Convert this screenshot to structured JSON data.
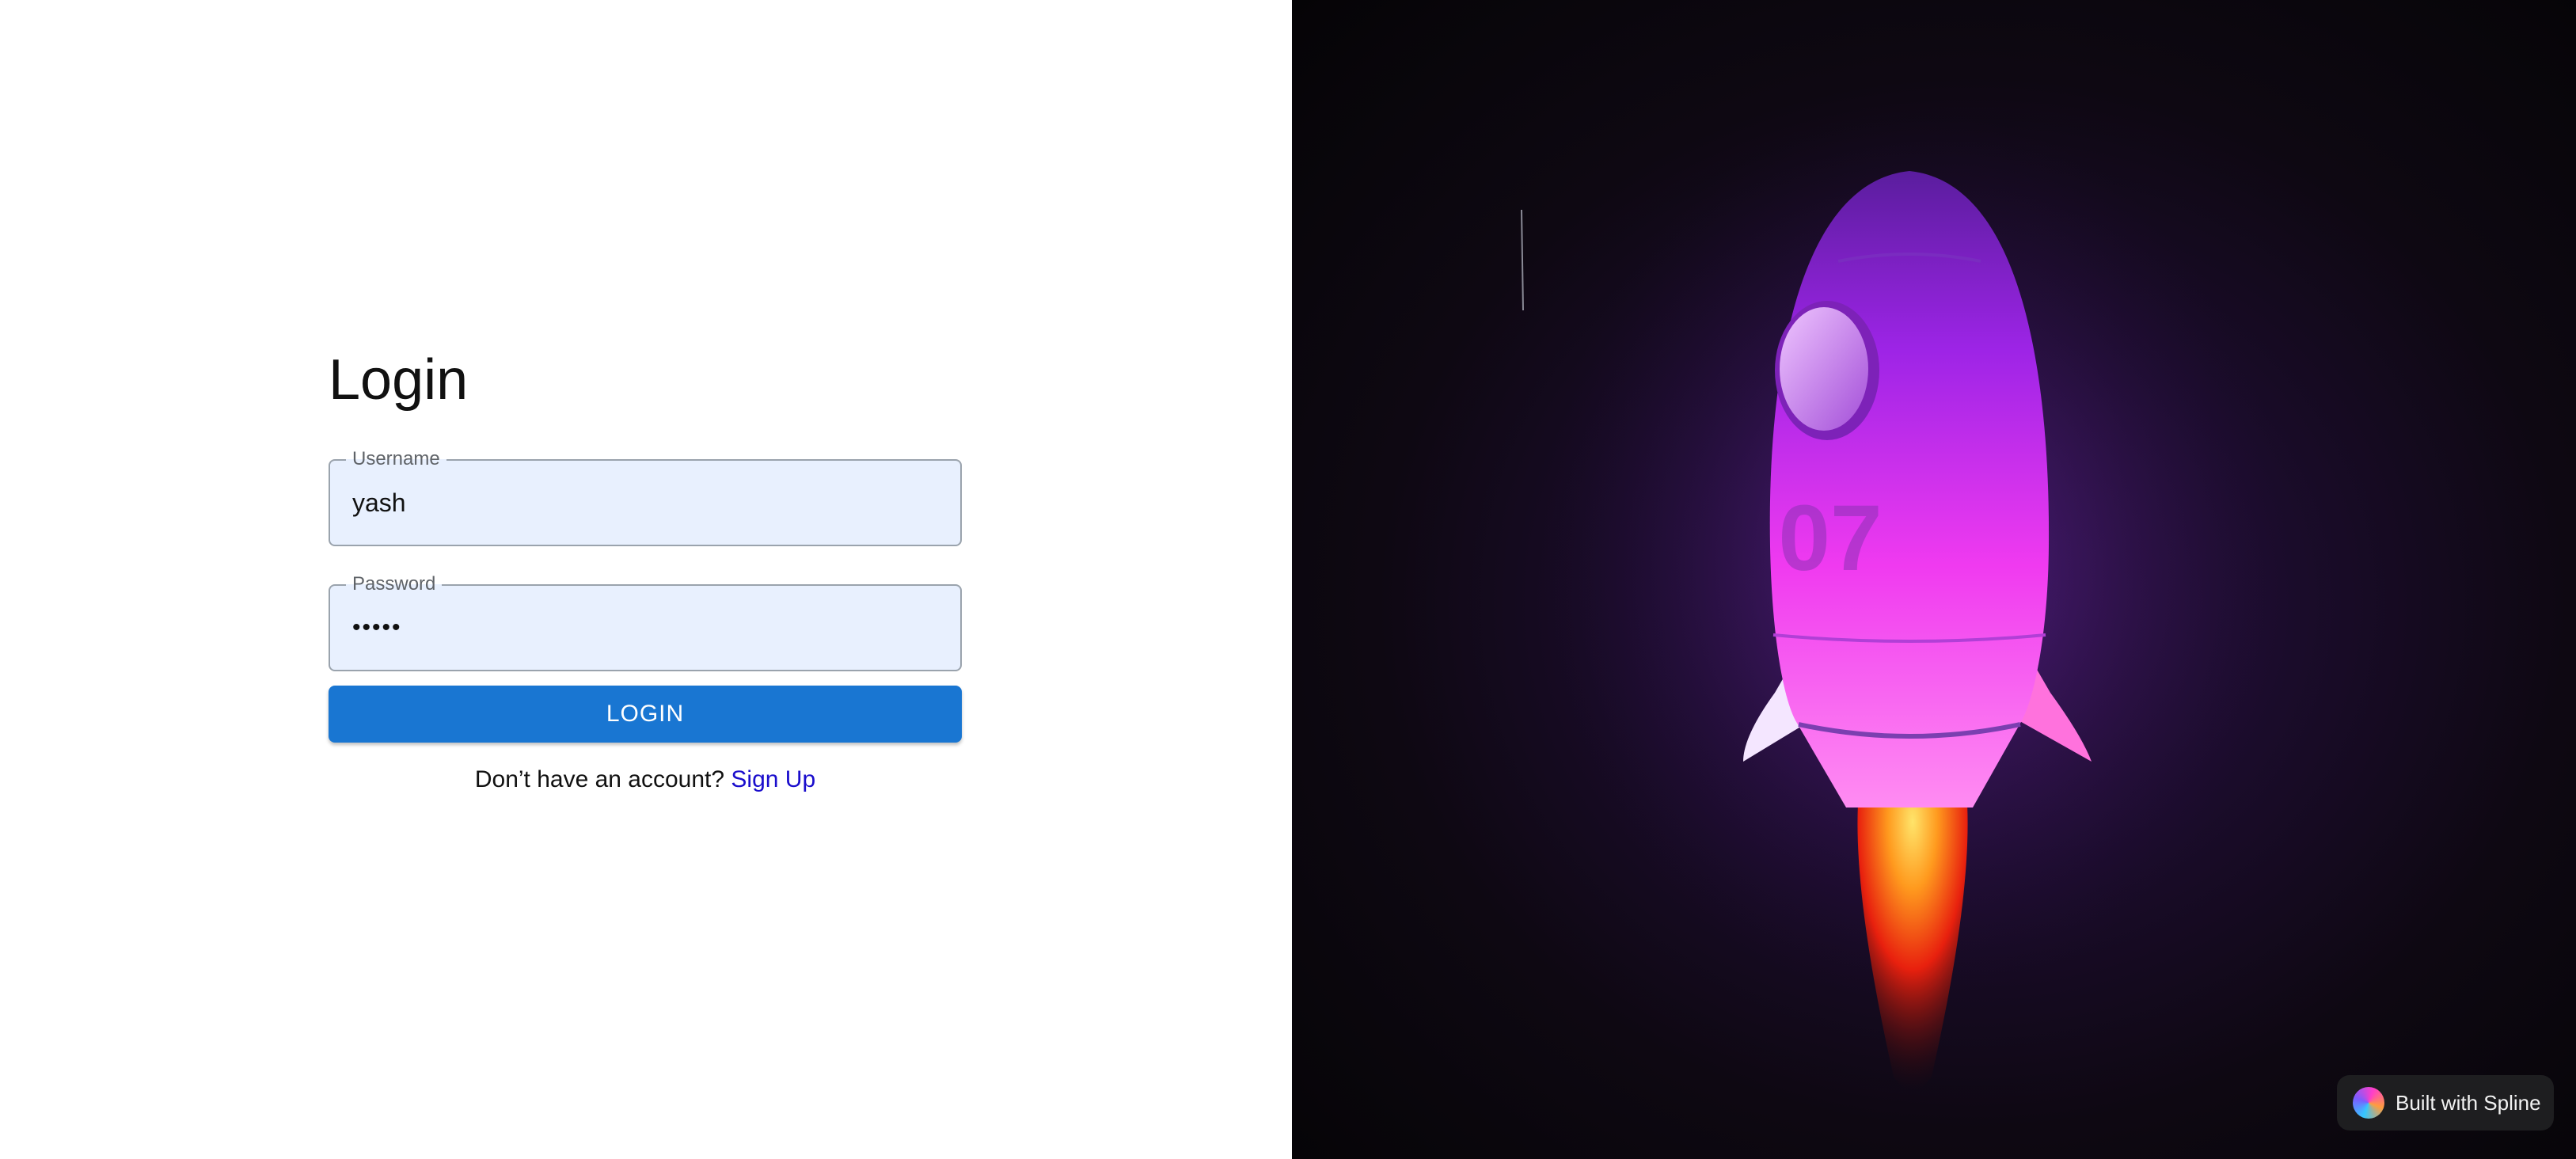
{
  "login": {
    "title": "Login",
    "username": {
      "label": "Username",
      "value": "yash"
    },
    "password": {
      "label": "Password",
      "value": "•••••"
    },
    "submit_label": "LOGIN",
    "signup_prompt": "Don’t have an account?",
    "signup_link": "Sign Up"
  },
  "illustration": {
    "rocket_number": "07",
    "badge_text": "Built with Spline"
  },
  "colors": {
    "primary_button": "#1976d2",
    "input_fill": "#e8f0fe",
    "link": "#1a0dcc",
    "rocket_body": "#d23cf0",
    "background_dark": "#0e0812"
  }
}
